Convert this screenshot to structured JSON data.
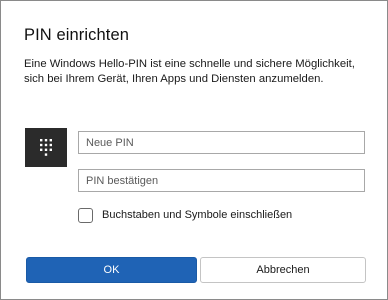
{
  "dialog": {
    "title": "PIN einrichten",
    "description": "Eine Windows Hello-PIN ist eine schnelle und sichere Möglichkeit, sich bei Ihrem Gerät, Ihren Apps und Diensten anzumelden."
  },
  "icons": {
    "keypad": "keypad-icon"
  },
  "fields": {
    "new_pin": {
      "placeholder": "Neue PIN",
      "value": ""
    },
    "confirm_pin": {
      "placeholder": "PIN bestätigen",
      "value": ""
    }
  },
  "options": {
    "letters_symbols": {
      "label": "Buchstaben und Symbole einschließen",
      "checked": false
    }
  },
  "buttons": {
    "ok": "OK",
    "cancel": "Abbrechen"
  },
  "colors": {
    "primary": "#1f63b5",
    "keypad_bg": "#2b2b2b"
  }
}
